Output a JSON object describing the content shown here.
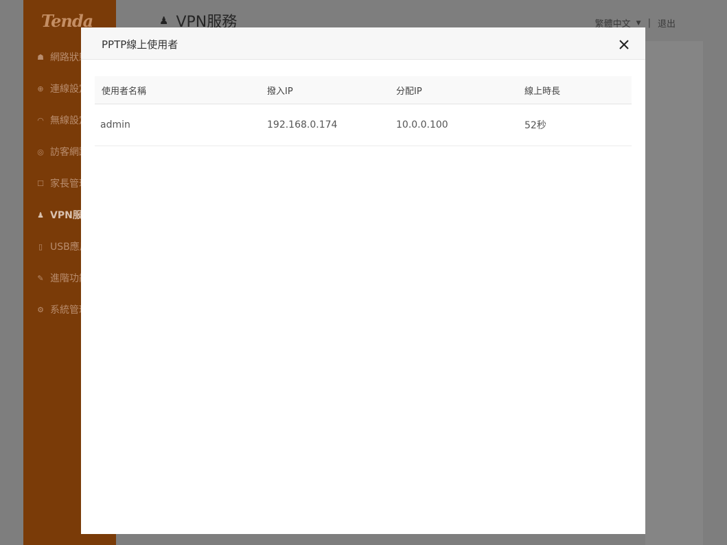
{
  "app": {
    "logo": "Tenda",
    "page_title": "VPN服務",
    "language": "繁體中文",
    "separator": "|",
    "logout": "退出"
  },
  "sidebar": {
    "items": [
      {
        "label": "網路狀態",
        "icon": "router-icon"
      },
      {
        "label": "連線設定",
        "icon": "globe-icon"
      },
      {
        "label": "無線設定",
        "icon": "wifi-icon"
      },
      {
        "label": "訪客網路",
        "icon": "bulb-icon"
      },
      {
        "label": "家長管理",
        "icon": "parental-icon"
      },
      {
        "label": "VPN服務",
        "icon": "vpn-icon",
        "active": true
      },
      {
        "label": "USB應用",
        "icon": "usb-icon"
      },
      {
        "label": "進階功能",
        "icon": "wrench-icon"
      },
      {
        "label": "系統管理",
        "icon": "gear-icon"
      }
    ]
  },
  "modal": {
    "title": "PPTP線上使用者",
    "table": {
      "headers": [
        "使用者名稱",
        "撥入IP",
        "分配IP",
        "線上時長"
      ],
      "rows": [
        [
          "admin",
          "192.168.0.174",
          "10.0.0.100",
          "52秒"
        ]
      ]
    }
  }
}
